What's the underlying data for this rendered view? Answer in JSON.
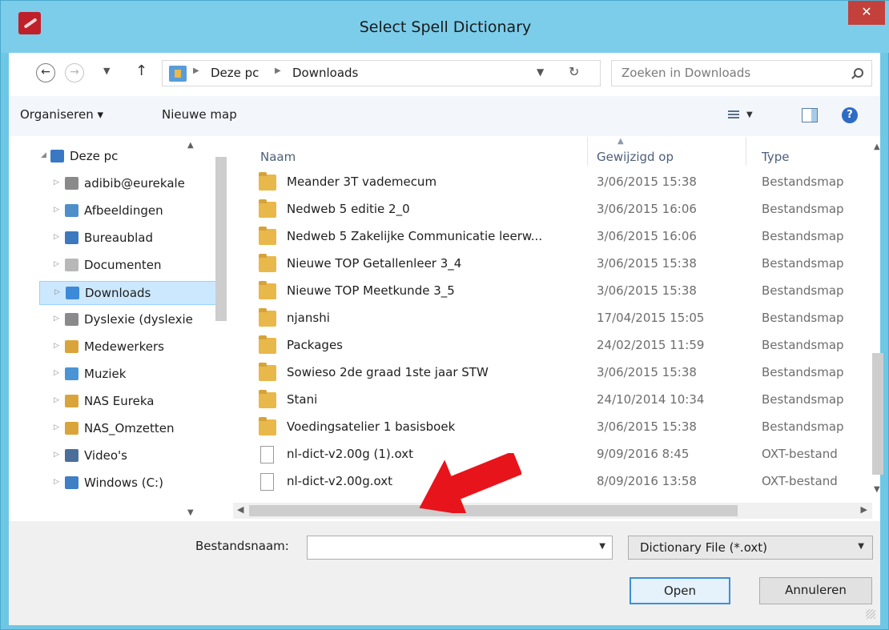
{
  "window": {
    "title": "Select Spell Dictionary",
    "close_glyph": "✕"
  },
  "address": {
    "crumbs": [
      "Deze pc",
      "Downloads"
    ],
    "search_placeholder": "Zoeken in Downloads"
  },
  "toolbar": {
    "organize_label": "Organiseren ▾",
    "new_folder_label": "Nieuwe map"
  },
  "nav_items": [
    {
      "label": "Deze pc",
      "icon": "computer-icon",
      "color": "#3b78c4"
    },
    {
      "label": "adibib@eurekale",
      "icon": "network-user-icon",
      "color": "#8a8a8a"
    },
    {
      "label": "Afbeeldingen",
      "icon": "pictures-icon",
      "color": "#4f8fc9"
    },
    {
      "label": "Bureaublad",
      "icon": "desktop-icon",
      "color": "#3d79bf"
    },
    {
      "label": "Documenten",
      "icon": "documents-icon",
      "color": "#b8b8b8"
    },
    {
      "label": "Downloads",
      "icon": "downloads-icon",
      "color": "#3d8ad9",
      "selected": true
    },
    {
      "label": "Dyslexie (dyslexie",
      "icon": "network-user-icon",
      "color": "#8a8a8a"
    },
    {
      "label": "Medewerkers",
      "icon": "network-drive-icon",
      "color": "#d9a53a"
    },
    {
      "label": "Muziek",
      "icon": "music-icon",
      "color": "#4a94d6"
    },
    {
      "label": "NAS Eureka",
      "icon": "network-drive-icon",
      "color": "#d9a53a"
    },
    {
      "label": "NAS_Omzetten",
      "icon": "network-drive-icon",
      "color": "#d9a53a"
    },
    {
      "label": "Video's",
      "icon": "videos-icon",
      "color": "#4b6f9a"
    },
    {
      "label": "Windows (C:)",
      "icon": "drive-icon",
      "color": "#3f7fc4"
    }
  ],
  "columns": {
    "name": "Naam",
    "date": "Gewijzigd op",
    "type": "Type"
  },
  "files": [
    {
      "name": "Meander 3T vademecum",
      "date": "3/06/2015 15:38",
      "type": "Bestandsmap",
      "kind": "folder"
    },
    {
      "name": "Nedweb 5 editie 2_0",
      "date": "3/06/2015 16:06",
      "type": "Bestandsmap",
      "kind": "folder"
    },
    {
      "name": "Nedweb 5 Zakelijke Communicatie leerw...",
      "date": "3/06/2015 16:06",
      "type": "Bestandsmap",
      "kind": "folder"
    },
    {
      "name": "Nieuwe TOP Getallenleer 3_4",
      "date": "3/06/2015 15:38",
      "type": "Bestandsmap",
      "kind": "folder"
    },
    {
      "name": "Nieuwe TOP Meetkunde 3_5",
      "date": "3/06/2015 15:38",
      "type": "Bestandsmap",
      "kind": "folder"
    },
    {
      "name": "njanshi",
      "date": "17/04/2015 15:05",
      "type": "Bestandsmap",
      "kind": "folder"
    },
    {
      "name": "Packages",
      "date": "24/02/2015 11:59",
      "type": "Bestandsmap",
      "kind": "folder"
    },
    {
      "name": "Sowieso 2de graad 1ste jaar STW",
      "date": "3/06/2015 15:38",
      "type": "Bestandsmap",
      "kind": "folder"
    },
    {
      "name": "Stani",
      "date": "24/10/2014 10:34",
      "type": "Bestandsmap",
      "kind": "folder"
    },
    {
      "name": "Voedingsatelier 1 basisboek",
      "date": "3/06/2015 15:38",
      "type": "Bestandsmap",
      "kind": "folder"
    },
    {
      "name": "nl-dict-v2.00g (1).oxt",
      "date": "9/09/2016 8:45",
      "type": "OXT-bestand",
      "kind": "file"
    },
    {
      "name": "nl-dict-v2.00g.oxt",
      "date": "8/09/2016 13:58",
      "type": "OXT-bestand",
      "kind": "file"
    }
  ],
  "bottom": {
    "filename_label": "Bestandsnaam:",
    "filename_value": "",
    "filter_label": "Dictionary File (*.oxt)",
    "open_label": "Open",
    "cancel_label": "Annuleren"
  },
  "colors": {
    "title_bar": "#7ccdea",
    "close": "#c4403b",
    "selection": "#cce8ff",
    "arrow": "#e8141b"
  }
}
